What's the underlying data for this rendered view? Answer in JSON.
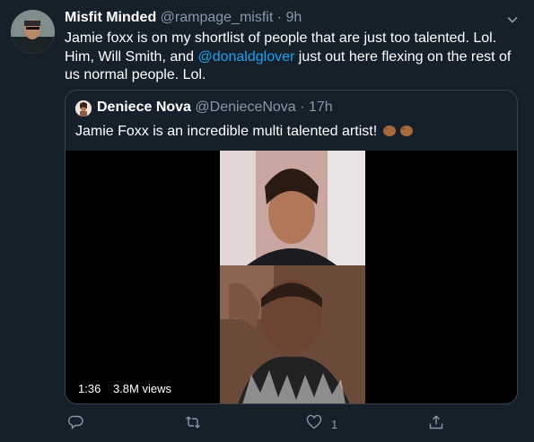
{
  "tweet": {
    "display_name": "Misfit Minded",
    "handle": "@rampage_misfit",
    "separator": "·",
    "time": "9h",
    "text_before": "Jamie foxx is on my shortlist of people that are just too talented. Lol. Him, Will Smith, and ",
    "mention": "@donaldglover",
    "text_after": " just out here flexing on the rest of us normal people. Lol."
  },
  "quoted_tweet": {
    "display_name": "Deniece Nova",
    "handle": "@DenieceNova",
    "separator": "·",
    "time": "17h",
    "text": "Jamie Foxx is an incredible multi talented artist!",
    "emoji_icon": "clapping-hands-icon",
    "video": {
      "duration": "1:36",
      "views": "3.8M views"
    }
  },
  "actions": {
    "reply_icon": "reply-icon",
    "retweet_icon": "retweet-icon",
    "like_icon": "heart-icon",
    "like_count": "1",
    "share_icon": "share-icon"
  },
  "colors": {
    "background": "#15202b",
    "text": "#ffffff",
    "muted": "#8899a6",
    "link": "#1da1f2",
    "border": "#38444d"
  }
}
